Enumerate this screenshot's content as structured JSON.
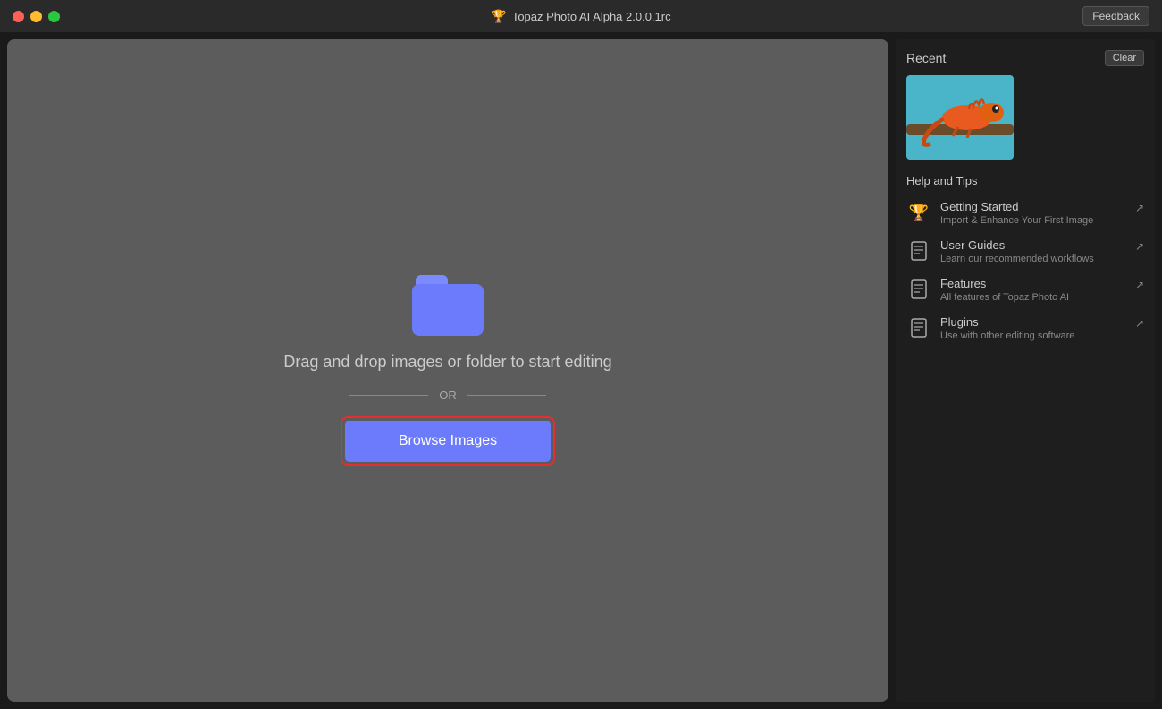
{
  "titlebar": {
    "title": "Topaz Photo AI Alpha 2.0.0.1rc",
    "feedback_label": "Feedback"
  },
  "drop_zone": {
    "drag_text": "Drag and drop images\nor folder to start\nediting",
    "or_text": "OR",
    "browse_label": "Browse Images"
  },
  "sidebar": {
    "recent_label": "Recent",
    "clear_label": "Clear",
    "help_tips_label": "Help and Tips",
    "help_items": [
      {
        "id": "getting-started",
        "title": "Getting Started",
        "subtitle": "Import & Enhance Your First Image",
        "icon_type": "topaz"
      },
      {
        "id": "user-guides",
        "title": "User Guides",
        "subtitle": "Learn our recommended workflows",
        "icon_type": "doc"
      },
      {
        "id": "features",
        "title": "Features",
        "subtitle": "All features of Topaz Photo AI",
        "icon_type": "doc"
      },
      {
        "id": "plugins",
        "title": "Plugins",
        "subtitle": "Use with other editing software",
        "icon_type": "doc"
      }
    ]
  }
}
